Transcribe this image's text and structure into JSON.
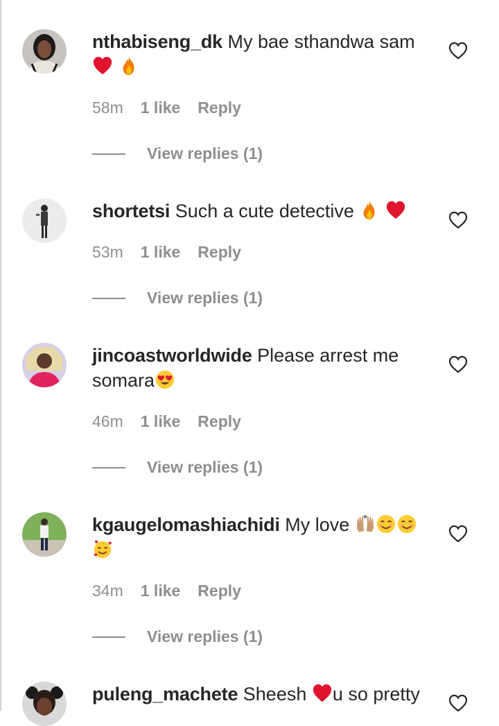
{
  "comments": [
    {
      "username": "nthabiseng_dk",
      "text": "My bae sthandwa sam",
      "emojis": [
        "red-heart",
        "fire"
      ],
      "time": "58m",
      "likes": "1 like",
      "reply_label": "Reply",
      "view_replies": "View replies (1)"
    },
    {
      "username": "shortetsi",
      "text": "Such a cute detective",
      "emojis": [
        "fire",
        "red-heart"
      ],
      "time": "53m",
      "likes": "1 like",
      "reply_label": "Reply",
      "view_replies": "View replies (1)"
    },
    {
      "username": "jincoastworldwide",
      "text": "Please arrest me somara",
      "emojis": [
        "heart-eyes-face"
      ],
      "time": "46m",
      "likes": "1 like",
      "reply_label": "Reply",
      "view_replies": "View replies (1)"
    },
    {
      "username": "kgaugelomashiachidi",
      "text": "My love",
      "emojis": [
        "raising-hands",
        "smiling-face",
        "smiling-face",
        "smiling-face-with-hearts"
      ],
      "time": "34m",
      "likes": "1 like",
      "reply_label": "Reply",
      "view_replies": "View replies (1)"
    },
    {
      "username": "puleng_machete",
      "text": "Sheesh",
      "text2": "u so pretty",
      "emojis": [
        "red-heart"
      ]
    }
  ],
  "colors": {
    "text": "#262626",
    "muted": "#8e8e8e",
    "heart": "#e0152d",
    "fire": "#f57c00"
  }
}
